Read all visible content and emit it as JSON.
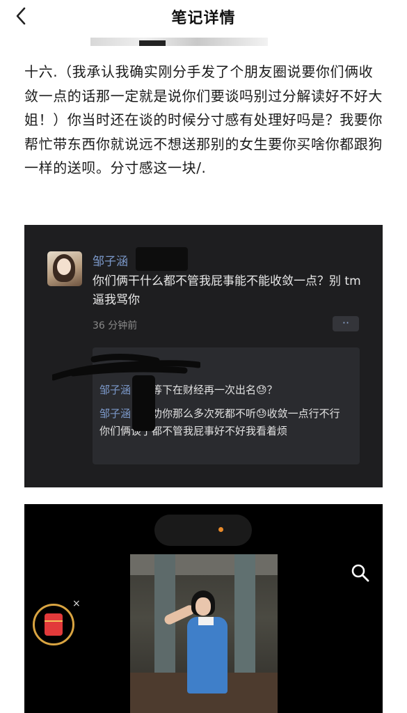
{
  "header": {
    "title": "笔记详情",
    "back_icon": "chevron-left-icon"
  },
  "article": {
    "text": "十六.（我承认我确实刚分手发了个朋友圈说要你们俩收敛一点的话那一定就是说你们要谈吗别过分解读好不好大姐！）你当时还在谈的时候分寸感有处理好吗是？我要你帮忙带东西你就说远不想送那别的女生要你买啥你都跟狗一样的送呗。分寸感这一块/."
  },
  "moment": {
    "author": "邹子涵",
    "text": "你们俩干什么都不管我屁事能不能收敛一点？别 tm 逼我骂你",
    "time": "36 分钟前",
    "more_label": "··",
    "comments": [
      {
        "name": "邹子涵",
        "text": "：别等下在财经再一次出名😓？"
      },
      {
        "name": "邹子涵",
        "text": "：我劝你那么多次死都不听😓收敛一点行不行你们俩谈了都不管我屁事好不好我看着烦"
      }
    ]
  },
  "video": {
    "search_icon": "search-icon",
    "red_packet_icon": "red-packet-icon",
    "close_label": "×",
    "accent_color": "#e88a2a"
  }
}
